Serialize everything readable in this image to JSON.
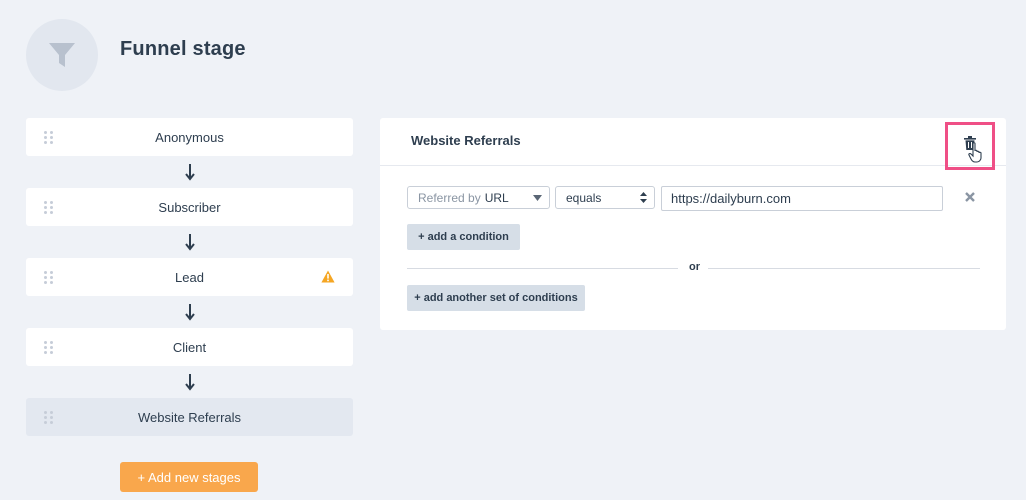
{
  "page": {
    "title": "Funnel stage",
    "icon": "funnel-icon"
  },
  "stages": [
    {
      "label": "Anonymous",
      "warning": false,
      "selected": false
    },
    {
      "label": "Subscriber",
      "warning": false,
      "selected": false
    },
    {
      "label": "Lead",
      "warning": true,
      "selected": false
    },
    {
      "label": "Client",
      "warning": false,
      "selected": false
    },
    {
      "label": "Website Referrals",
      "warning": false,
      "selected": true
    }
  ],
  "add_stage_button": "+ Add new stages",
  "panel": {
    "title": "Website Referrals",
    "condition": {
      "field_prefix": "Referred by",
      "field_value": "URL",
      "operator": "equals",
      "value": "https://dailyburn.com"
    },
    "add_condition_label": "add a condition",
    "or_label": "or",
    "add_set_label": "add another set of conditions"
  },
  "colors": {
    "background": "#eff2f7",
    "accent_orange": "#f9a74c",
    "highlight_pink": "#ef4f86",
    "warning": "#f5a623",
    "text": "#2e3e4f"
  }
}
